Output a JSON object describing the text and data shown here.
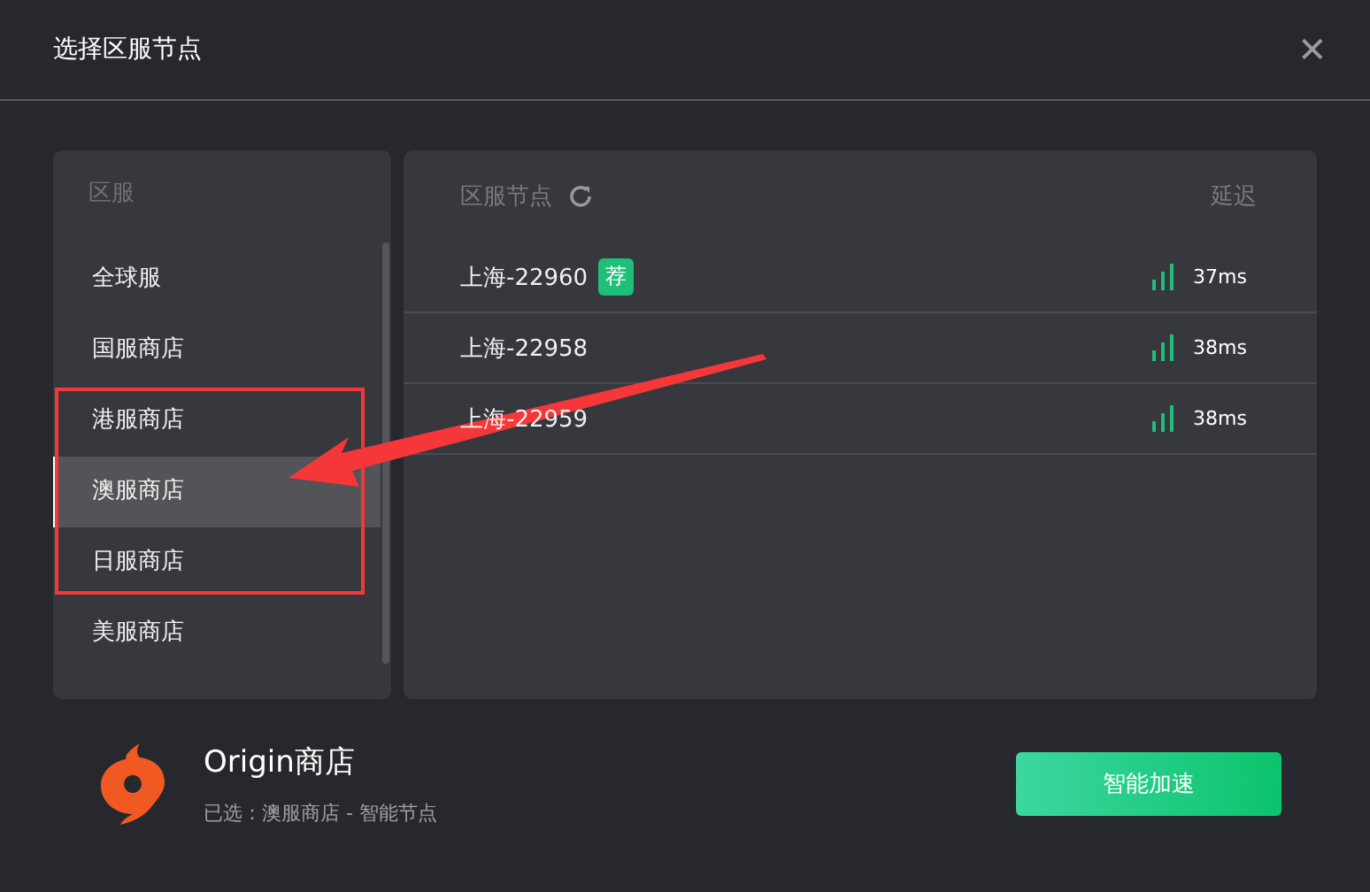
{
  "window": {
    "title": "选择区服节点",
    "close": "✕"
  },
  "regions": {
    "header": "区服",
    "items": [
      {
        "label": "全球服",
        "selected": false
      },
      {
        "label": "国服商店",
        "selected": false
      },
      {
        "label": "港服商店",
        "selected": false
      },
      {
        "label": "澳服商店",
        "selected": true
      },
      {
        "label": "日服商店",
        "selected": false
      },
      {
        "label": "美服商店",
        "selected": false
      }
    ]
  },
  "nodes": {
    "header": "区服节点",
    "latency_header": "延迟",
    "rows": [
      {
        "name": "上海-22960",
        "badge": "荐",
        "latency": "37ms"
      },
      {
        "name": "上海-22958",
        "latency": "38ms"
      },
      {
        "name": "上海-22959",
        "latency": "38ms"
      }
    ]
  },
  "footer": {
    "app_name": "Origin商店",
    "selection": "已选：澳服商店 - 智能节点",
    "button": "智能加速"
  },
  "annotations": {
    "box": true,
    "arrow": true
  }
}
